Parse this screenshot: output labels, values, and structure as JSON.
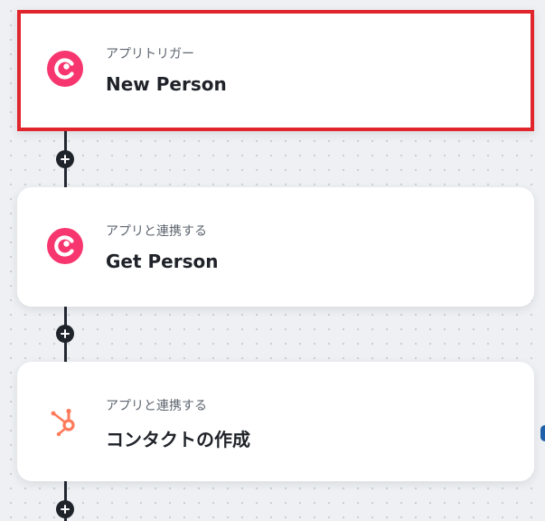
{
  "colors": {
    "selected_border": "#e0252c",
    "connector": "#222831",
    "copper_accent": "#f7366f",
    "hubspot_accent": "#ff7a59"
  },
  "steps": [
    {
      "kind": "アプリトリガー",
      "title": "New Person",
      "app_icon": "copper-logo-icon",
      "selected": true
    },
    {
      "kind": "アプリと連携する",
      "title": "Get Person",
      "app_icon": "copper-logo-icon",
      "selected": false
    },
    {
      "kind": "アプリと連携する",
      "title": "コンタクトの作成",
      "app_icon": "hubspot-logo-icon",
      "selected": false
    }
  ],
  "add_step_icon": "plus-icon"
}
